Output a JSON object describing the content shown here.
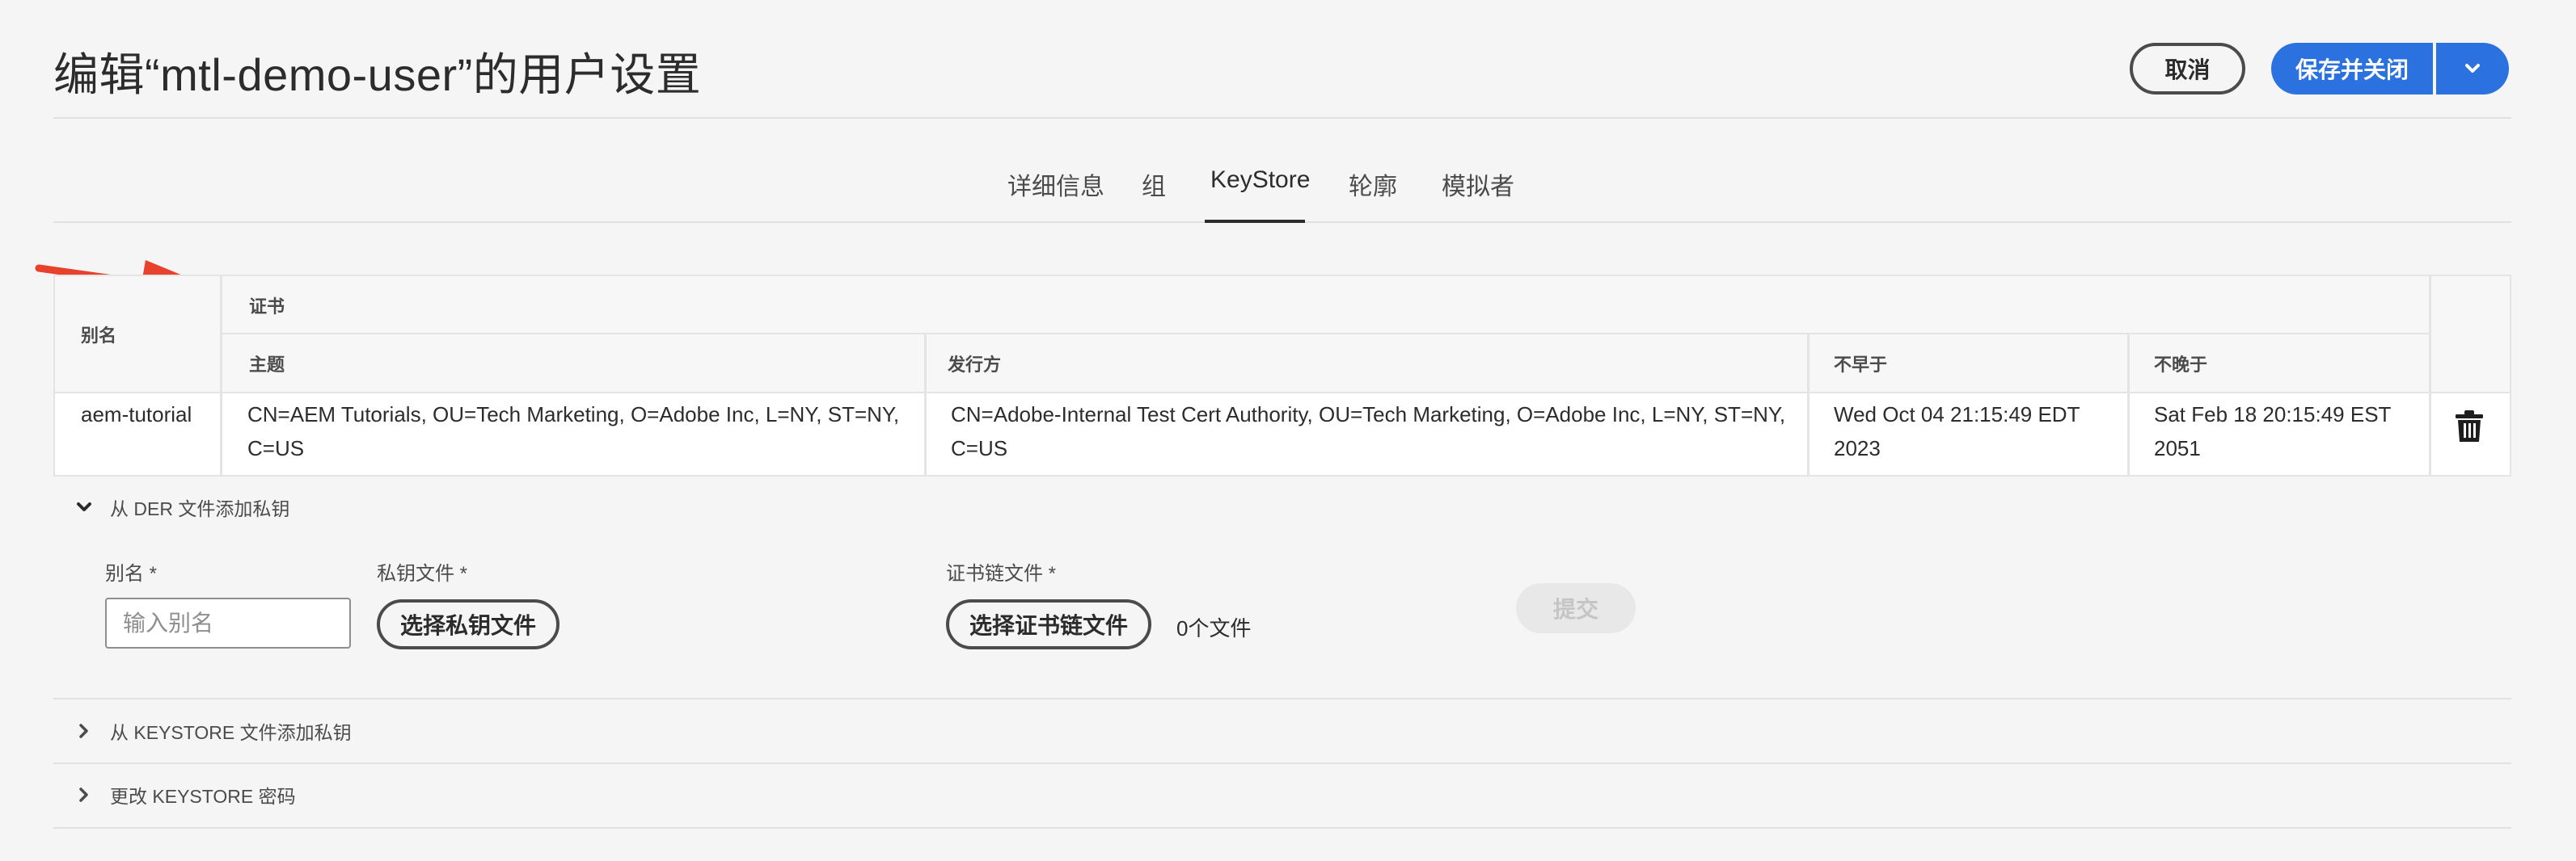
{
  "header": {
    "title": "编辑“mtl-demo-user”的用户设置",
    "cancel_label": "取消",
    "save_label": "保存并关闭"
  },
  "tabs": [
    {
      "label": "详细信息"
    },
    {
      "label": "组"
    },
    {
      "label": "KeyStore",
      "selected": true
    },
    {
      "label": "轮廓"
    },
    {
      "label": "模拟者"
    }
  ],
  "table": {
    "alias_header": "别名",
    "cert_group_header": "证书",
    "columns": [
      "主题",
      "发行方",
      "不早于",
      "不晚于"
    ],
    "rows": [
      {
        "alias": "aem-tutorial",
        "subject": "CN=AEM Tutorials, OU=Tech Marketing, O=Adobe Inc, L=NY, ST=NY, C=US",
        "issuer": "CN=Adobe-Internal Test Cert Authority, OU=Tech Marketing, O=Adobe Inc, L=NY, ST=NY, C=US",
        "not_before": "Wed Oct 04 21:15:49 EDT 2023",
        "not_after": "Sat Feb 18 20:15:49 EST 2051"
      }
    ]
  },
  "der_section": {
    "title": "从 DER 文件添加私钥",
    "alias_label": "别名 *",
    "alias_placeholder": "输入别名",
    "private_key_label": "私钥文件 *",
    "private_key_button": "选择私钥文件",
    "cert_chain_label": "证书链文件 *",
    "cert_chain_button": "选择证书链文件",
    "file_count": "0个文件",
    "submit_label": "提交"
  },
  "keystore_section": {
    "title": "从 KEYSTORE 文件添加私钥"
  },
  "password_section": {
    "title": "更改 KEYSTORE 密码"
  },
  "colors": {
    "accent": "#2b72e0",
    "annotation_arrow": "#e8412c",
    "background": "#f5f5f5"
  },
  "icons": {
    "save_menu": "chevron-down-icon",
    "delete": "trash-icon",
    "expanded": "chevron-down-icon",
    "collapsed": "chevron-right-icon"
  }
}
